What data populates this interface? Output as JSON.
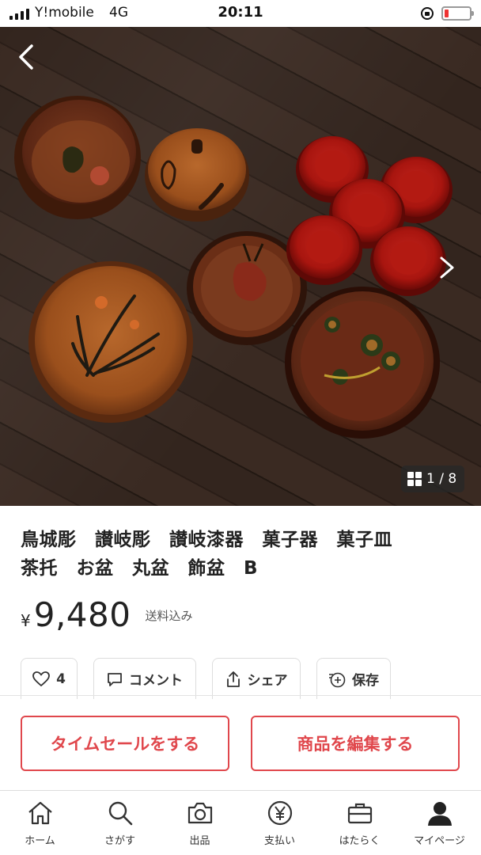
{
  "status_bar": {
    "carrier": "Y!mobile",
    "network": "4G",
    "time": "20:11"
  },
  "photo": {
    "image_counter": "1 / 8"
  },
  "item": {
    "title_line1": "鳥城彫　讃岐彫　讃岐漆器　菓子器　菓子皿",
    "title_line2": "茶托　お盆　丸盆　飾盆　B",
    "currency": "¥",
    "price": "9,480",
    "shipping_note": "送料込み"
  },
  "actions": {
    "like_count": "4",
    "comment_label": "コメント",
    "share_label": "シェア",
    "save_label": "保存"
  },
  "buttons": {
    "time_sale": "タイムセールをする",
    "edit_item": "商品を編集する"
  },
  "tabbar": {
    "items": [
      {
        "label": "ホーム",
        "icon": "home-icon"
      },
      {
        "label": "さがす",
        "icon": "search-icon"
      },
      {
        "label": "出品",
        "icon": "camera-icon"
      },
      {
        "label": "支払い",
        "icon": "yen-icon"
      },
      {
        "label": "はたらく",
        "icon": "briefcase-icon"
      },
      {
        "label": "マイページ",
        "icon": "person-icon"
      }
    ]
  },
  "colors": {
    "accent_red": "#e0474c",
    "battery_low": "#e33333"
  }
}
